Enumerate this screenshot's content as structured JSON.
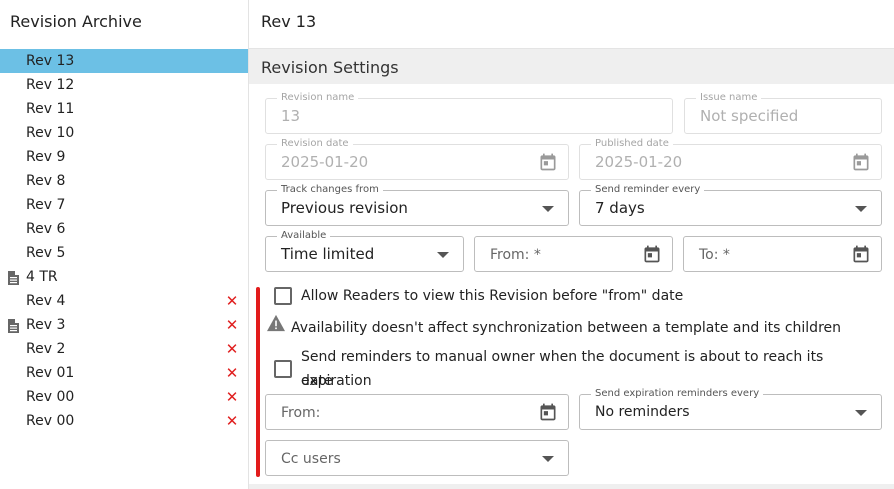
{
  "sidebar": {
    "title": "Revision Archive",
    "items": [
      {
        "label": "Rev 13",
        "selected": true,
        "doc_icon": false,
        "delete": false
      },
      {
        "label": "Rev 12",
        "selected": false,
        "doc_icon": false,
        "delete": false
      },
      {
        "label": "Rev 11",
        "selected": false,
        "doc_icon": false,
        "delete": false
      },
      {
        "label": "Rev 10",
        "selected": false,
        "doc_icon": false,
        "delete": false
      },
      {
        "label": "Rev 9",
        "selected": false,
        "doc_icon": false,
        "delete": false
      },
      {
        "label": "Rev 8",
        "selected": false,
        "doc_icon": false,
        "delete": false
      },
      {
        "label": "Rev 7",
        "selected": false,
        "doc_icon": false,
        "delete": false
      },
      {
        "label": "Rev 6",
        "selected": false,
        "doc_icon": false,
        "delete": false
      },
      {
        "label": "Rev 5",
        "selected": false,
        "doc_icon": false,
        "delete": false
      },
      {
        "label": "4 TR",
        "selected": false,
        "doc_icon": true,
        "delete": false
      },
      {
        "label": "Rev 4",
        "selected": false,
        "doc_icon": false,
        "delete": true
      },
      {
        "label": "Rev 3",
        "selected": false,
        "doc_icon": true,
        "delete": true
      },
      {
        "label": "Rev 2",
        "selected": false,
        "doc_icon": false,
        "delete": true
      },
      {
        "label": "Rev 01",
        "selected": false,
        "doc_icon": false,
        "delete": true
      },
      {
        "label": "Rev 00",
        "selected": false,
        "doc_icon": false,
        "delete": true
      },
      {
        "label": "Rev 00",
        "selected": false,
        "doc_icon": false,
        "delete": true
      }
    ],
    "delete_glyph": "✕",
    "icons": {
      "document": "document-icon",
      "delete": "delete-icon"
    }
  },
  "main": {
    "title": "Rev 13",
    "section_title": "Revision Settings",
    "revision_name": {
      "label": "Revision name",
      "value": "13"
    },
    "issue_name": {
      "label": "Issue name",
      "value": "Not specified"
    },
    "revision_date": {
      "label": "Revision date",
      "value": "2025-01-20"
    },
    "published_date": {
      "label": "Published date",
      "value": "2025-01-20"
    },
    "track_changes": {
      "label": "Track changes from",
      "value": "Previous revision"
    },
    "send_reminder": {
      "label": "Send reminder every",
      "value": "7 days"
    },
    "available": {
      "label": "Available",
      "value": "Time limited"
    },
    "from_required": {
      "placeholder": "From: *"
    },
    "to_required": {
      "placeholder": "To: *"
    },
    "allow_readers": {
      "label": "Allow Readers to view this Revision before \"from\" date",
      "checked": false
    },
    "availability_warning": "Availability doesn't affect synchronization between a template and its children",
    "send_reminders_owner": {
      "label_line1": "Send reminders to manual owner when the document is about to reach its expiration",
      "label_line2": "date",
      "checked": false
    },
    "expiration_from": {
      "placeholder": "From:"
    },
    "expiration_reminders": {
      "label": "Send expiration reminders every",
      "value": "No reminders"
    },
    "cc_users": {
      "placeholder": "Cc users"
    }
  },
  "colors": {
    "selected_row": "#6cc0e5",
    "delete": "#e02020",
    "annotation_bar": "#e21b1b",
    "section_header": "#efefef"
  },
  "icons": [
    "calendar-icon",
    "chevron-down-icon",
    "warning-icon",
    "document-icon",
    "delete-icon",
    "checkbox"
  ]
}
